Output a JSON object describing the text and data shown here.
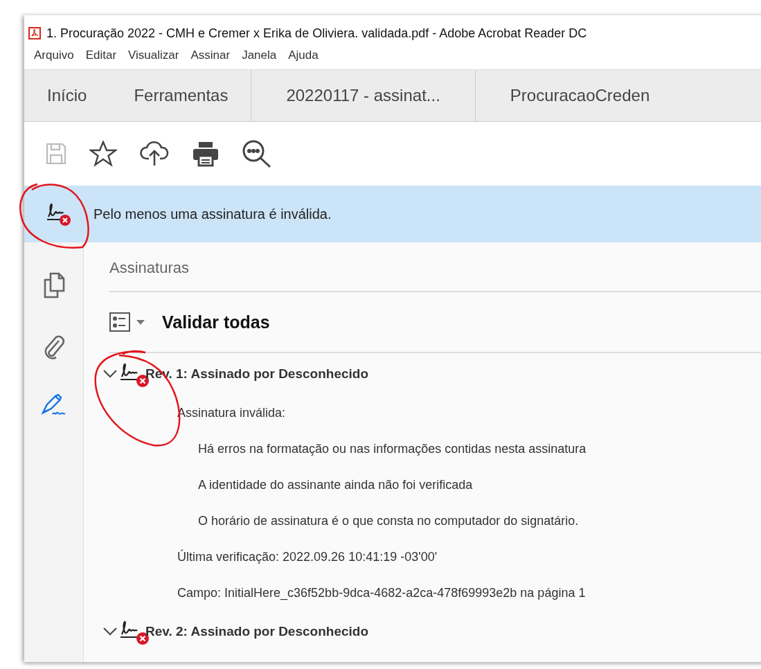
{
  "window": {
    "title": "1. Procuração 2022 - CMH e Cremer x Erika de Oliviera. validada.pdf - Adobe Acrobat Reader DC"
  },
  "menu": [
    "Arquivo",
    "Editar",
    "Visualizar",
    "Assinar",
    "Janela",
    "Ajuda"
  ],
  "tabs": [
    {
      "label": "Início",
      "selected": false,
      "kind": "nav"
    },
    {
      "label": "Ferramentas",
      "selected": false,
      "kind": "nav"
    },
    {
      "label": "20220117 - assinat...",
      "selected": false,
      "kind": "doc"
    },
    {
      "label": "ProcuracaoCreden",
      "selected": false,
      "kind": "doc"
    }
  ],
  "toolbar": [
    {
      "kind": "save",
      "disabled": true
    },
    {
      "kind": "bookmark",
      "disabled": false
    },
    {
      "kind": "upload",
      "disabled": false
    },
    {
      "kind": "print",
      "disabled": false
    },
    {
      "kind": "search",
      "disabled": false
    }
  ],
  "sidebar": [
    {
      "kind": "pages",
      "selected": false
    },
    {
      "kind": "attachment",
      "selected": false
    },
    {
      "kind": "signature",
      "selected": true
    }
  ],
  "banner": {
    "message": "Pelo menos uma assinatura é inválida."
  },
  "panel": {
    "title": "Assinaturas",
    "validate_all": "Validar todas",
    "signatures": [
      {
        "title": "Rev. 1: Assinado por Desconhecido",
        "expanded": true,
        "status": "Assinatura inválida:",
        "details": [
          "Há erros na formatação ou nas informações contidas nesta assinatura",
          "A identidade do assinante ainda não foi verificada",
          "O horário de assinatura é o que consta no computador do signatário."
        ],
        "last_verified": "Última verificação: 2022.09.26 10:41:19 -03'00'",
        "field": "Campo: InitialHere_c36f52bb-9dca-4682-a2ca-478f69993e2b na página 1"
      },
      {
        "title": "Rev. 2: Assinado por Desconhecido",
        "expanded": true
      }
    ]
  }
}
